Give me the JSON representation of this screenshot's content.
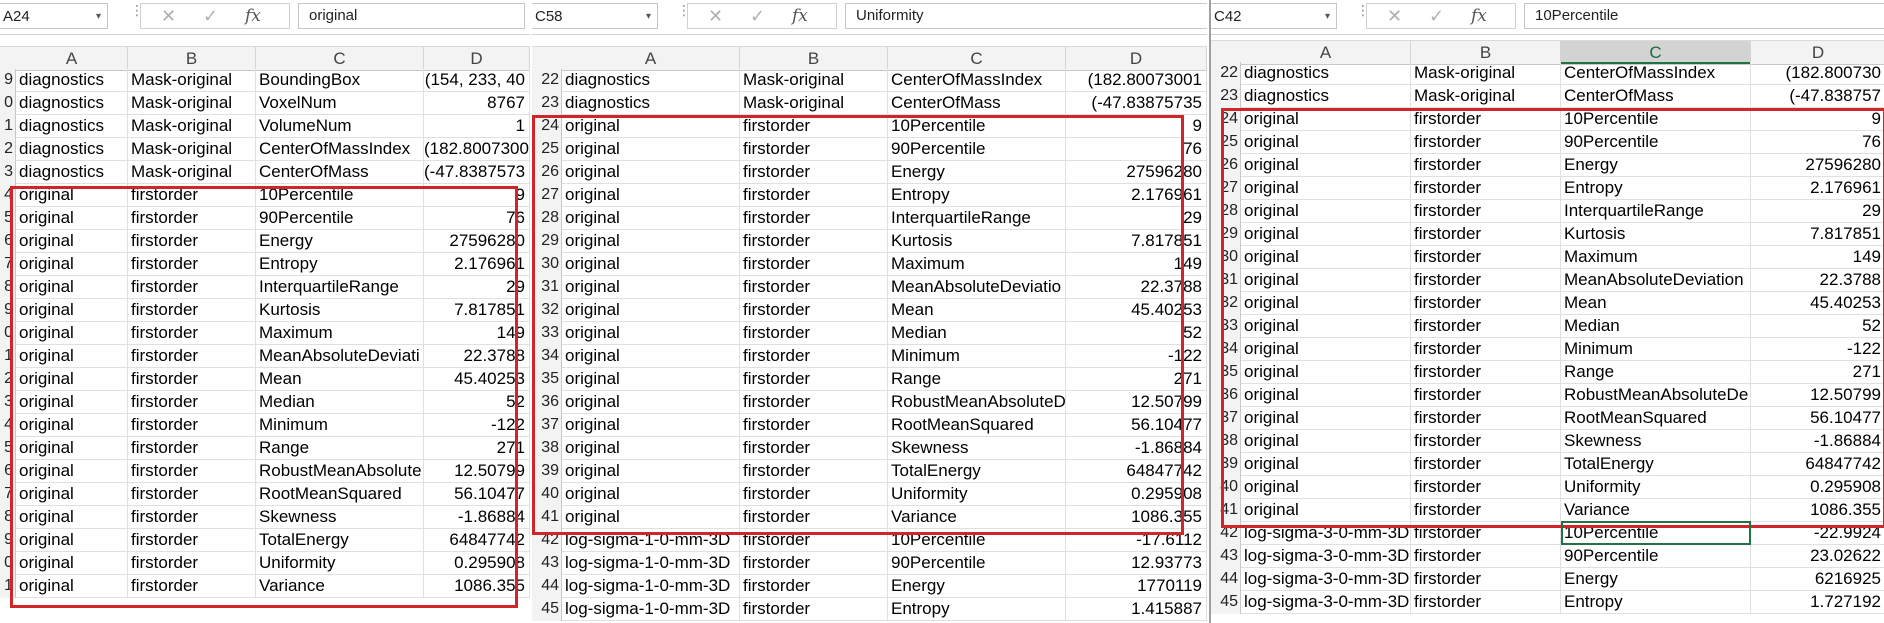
{
  "panels": [
    {
      "namebox": "A24",
      "formula": "original",
      "columns": [
        "A",
        "B",
        "C",
        "D"
      ],
      "rows": [
        {
          "n": "9",
          "a": "diagnostics",
          "b": "Mask-original",
          "c": "BoundingBox",
          "d": "(154, 233, 40"
        },
        {
          "n": "0",
          "a": "diagnostics",
          "b": "Mask-original",
          "c": "VoxelNum",
          "d": "8767"
        },
        {
          "n": "1",
          "a": "diagnostics",
          "b": "Mask-original",
          "c": "VolumeNum",
          "d": "1"
        },
        {
          "n": "2",
          "a": "diagnostics",
          "b": "Mask-original",
          "c": "CenterOfMassIndex",
          "d": "(182.8007300"
        },
        {
          "n": "3",
          "a": "diagnostics",
          "b": "Mask-original",
          "c": "CenterOfMass",
          "d": "(-47.8387573"
        },
        {
          "n": "4",
          "a": "original",
          "b": "firstorder",
          "c": "10Percentile",
          "d": "9"
        },
        {
          "n": "5",
          "a": "original",
          "b": "firstorder",
          "c": "90Percentile",
          "d": "76"
        },
        {
          "n": "6",
          "a": "original",
          "b": "firstorder",
          "c": "Energy",
          "d": "27596280"
        },
        {
          "n": "7",
          "a": "original",
          "b": "firstorder",
          "c": "Entropy",
          "d": "2.176961"
        },
        {
          "n": "8",
          "a": "original",
          "b": "firstorder",
          "c": "InterquartileRange",
          "d": "29"
        },
        {
          "n": "9",
          "a": "original",
          "b": "firstorder",
          "c": "Kurtosis",
          "d": "7.817851"
        },
        {
          "n": "0",
          "a": "original",
          "b": "firstorder",
          "c": "Maximum",
          "d": "149"
        },
        {
          "n": "1",
          "a": "original",
          "b": "firstorder",
          "c": "MeanAbsoluteDeviati",
          "d": "22.3788"
        },
        {
          "n": "2",
          "a": "original",
          "b": "firstorder",
          "c": "Mean",
          "d": "45.40253"
        },
        {
          "n": "3",
          "a": "original",
          "b": "firstorder",
          "c": "Median",
          "d": "52"
        },
        {
          "n": "4",
          "a": "original",
          "b": "firstorder",
          "c": "Minimum",
          "d": "-122"
        },
        {
          "n": "5",
          "a": "original",
          "b": "firstorder",
          "c": "Range",
          "d": "271"
        },
        {
          "n": "6",
          "a": "original",
          "b": "firstorder",
          "c": "RobustMeanAbsolute",
          "d": "12.50799"
        },
        {
          "n": "7",
          "a": "original",
          "b": "firstorder",
          "c": "RootMeanSquared",
          "d": "56.10477"
        },
        {
          "n": "8",
          "a": "original",
          "b": "firstorder",
          "c": "Skewness",
          "d": "-1.86884"
        },
        {
          "n": "9",
          "a": "original",
          "b": "firstorder",
          "c": "TotalEnergy",
          "d": "64847742"
        },
        {
          "n": "0",
          "a": "original",
          "b": "firstorder",
          "c": "Uniformity",
          "d": "0.295908"
        },
        {
          "n": "1",
          "a": "original",
          "b": "firstorder",
          "c": "Variance",
          "d": "1086.355"
        }
      ]
    },
    {
      "namebox": "C58",
      "formula": "Uniformity",
      "columns": [
        "A",
        "B",
        "C",
        "D"
      ],
      "rows": [
        {
          "n": "22",
          "a": "diagnostics",
          "b": "Mask-original",
          "c": "CenterOfMassIndex",
          "d": "(182.80073001"
        },
        {
          "n": "23",
          "a": "diagnostics",
          "b": "Mask-original",
          "c": "CenterOfMass",
          "d": "(-47.83875735"
        },
        {
          "n": "24",
          "a": "original",
          "b": "firstorder",
          "c": "10Percentile",
          "d": "9"
        },
        {
          "n": "25",
          "a": "original",
          "b": "firstorder",
          "c": "90Percentile",
          "d": "76"
        },
        {
          "n": "26",
          "a": "original",
          "b": "firstorder",
          "c": "Energy",
          "d": "27596280"
        },
        {
          "n": "27",
          "a": "original",
          "b": "firstorder",
          "c": "Entropy",
          "d": "2.176961"
        },
        {
          "n": "28",
          "a": "original",
          "b": "firstorder",
          "c": "InterquartileRange",
          "d": "29"
        },
        {
          "n": "29",
          "a": "original",
          "b": "firstorder",
          "c": "Kurtosis",
          "d": "7.817851"
        },
        {
          "n": "30",
          "a": "original",
          "b": "firstorder",
          "c": "Maximum",
          "d": "149"
        },
        {
          "n": "31",
          "a": "original",
          "b": "firstorder",
          "c": "MeanAbsoluteDeviatio",
          "d": "22.3788"
        },
        {
          "n": "32",
          "a": "original",
          "b": "firstorder",
          "c": "Mean",
          "d": "45.40253"
        },
        {
          "n": "33",
          "a": "original",
          "b": "firstorder",
          "c": "Median",
          "d": "52"
        },
        {
          "n": "34",
          "a": "original",
          "b": "firstorder",
          "c": "Minimum",
          "d": "-122"
        },
        {
          "n": "35",
          "a": "original",
          "b": "firstorder",
          "c": "Range",
          "d": "271"
        },
        {
          "n": "36",
          "a": "original",
          "b": "firstorder",
          "c": "RobustMeanAbsoluteD",
          "d": "12.50799"
        },
        {
          "n": "37",
          "a": "original",
          "b": "firstorder",
          "c": "RootMeanSquared",
          "d": "56.10477"
        },
        {
          "n": "38",
          "a": "original",
          "b": "firstorder",
          "c": "Skewness",
          "d": "-1.86884"
        },
        {
          "n": "39",
          "a": "original",
          "b": "firstorder",
          "c": "TotalEnergy",
          "d": "64847742"
        },
        {
          "n": "40",
          "a": "original",
          "b": "firstorder",
          "c": "Uniformity",
          "d": "0.295908"
        },
        {
          "n": "41",
          "a": "original",
          "b": "firstorder",
          "c": "Variance",
          "d": "1086.355"
        },
        {
          "n": "42",
          "a": "log-sigma-1-0-mm-3D",
          "b": "firstorder",
          "c": "10Percentile",
          "d": "-17.6112"
        },
        {
          "n": "43",
          "a": "log-sigma-1-0-mm-3D",
          "b": "firstorder",
          "c": "90Percentile",
          "d": "12.93773"
        },
        {
          "n": "44",
          "a": "log-sigma-1-0-mm-3D",
          "b": "firstorder",
          "c": "Energy",
          "d": "1770119"
        },
        {
          "n": "45",
          "a": "log-sigma-1-0-mm-3D",
          "b": "firstorder",
          "c": "Entropy",
          "d": "1.415887"
        }
      ]
    },
    {
      "namebox": "C42",
      "formula": "10Percentile",
      "columns": [
        "A",
        "B",
        "C",
        "D"
      ],
      "rows": [
        {
          "n": "22",
          "a": "diagnostics",
          "b": "Mask-original",
          "c": "CenterOfMassIndex",
          "d": "(182.800730"
        },
        {
          "n": "23",
          "a": "diagnostics",
          "b": "Mask-original",
          "c": "CenterOfMass",
          "d": "(-47.838757"
        },
        {
          "n": "24",
          "a": "original",
          "b": "firstorder",
          "c": "10Percentile",
          "d": "9"
        },
        {
          "n": "25",
          "a": "original",
          "b": "firstorder",
          "c": "90Percentile",
          "d": "76"
        },
        {
          "n": "26",
          "a": "original",
          "b": "firstorder",
          "c": "Energy",
          "d": "27596280"
        },
        {
          "n": "27",
          "a": "original",
          "b": "firstorder",
          "c": "Entropy",
          "d": "2.176961"
        },
        {
          "n": "28",
          "a": "original",
          "b": "firstorder",
          "c": "InterquartileRange",
          "d": "29"
        },
        {
          "n": "29",
          "a": "original",
          "b": "firstorder",
          "c": "Kurtosis",
          "d": "7.817851"
        },
        {
          "n": "30",
          "a": "original",
          "b": "firstorder",
          "c": "Maximum",
          "d": "149"
        },
        {
          "n": "31",
          "a": "original",
          "b": "firstorder",
          "c": "MeanAbsoluteDeviation",
          "d": "22.3788"
        },
        {
          "n": "32",
          "a": "original",
          "b": "firstorder",
          "c": "Mean",
          "d": "45.40253"
        },
        {
          "n": "33",
          "a": "original",
          "b": "firstorder",
          "c": "Median",
          "d": "52"
        },
        {
          "n": "34",
          "a": "original",
          "b": "firstorder",
          "c": "Minimum",
          "d": "-122"
        },
        {
          "n": "35",
          "a": "original",
          "b": "firstorder",
          "c": "Range",
          "d": "271"
        },
        {
          "n": "36",
          "a": "original",
          "b": "firstorder",
          "c": "RobustMeanAbsoluteDe",
          "d": "12.50799"
        },
        {
          "n": "37",
          "a": "original",
          "b": "firstorder",
          "c": "RootMeanSquared",
          "d": "56.10477"
        },
        {
          "n": "38",
          "a": "original",
          "b": "firstorder",
          "c": "Skewness",
          "d": "-1.86884"
        },
        {
          "n": "39",
          "a": "original",
          "b": "firstorder",
          "c": "TotalEnergy",
          "d": "64847742"
        },
        {
          "n": "40",
          "a": "original",
          "b": "firstorder",
          "c": "Uniformity",
          "d": "0.295908"
        },
        {
          "n": "41",
          "a": "original",
          "b": "firstorder",
          "c": "Variance",
          "d": "1086.355"
        },
        {
          "n": "42",
          "a": "log-sigma-3-0-mm-3D",
          "b": "firstorder",
          "c": "10Percentile",
          "d": "-22.9924"
        },
        {
          "n": "43",
          "a": "log-sigma-3-0-mm-3D",
          "b": "firstorder",
          "c": "90Percentile",
          "d": "23.02622"
        },
        {
          "n": "44",
          "a": "log-sigma-3-0-mm-3D",
          "b": "firstorder",
          "c": "Energy",
          "d": "6216925"
        },
        {
          "n": "45",
          "a": "log-sigma-3-0-mm-3D",
          "b": "firstorder",
          "c": "Entropy",
          "d": "1.727192"
        }
      ]
    }
  ],
  "icons": {
    "cancel": "✕",
    "enter": "✓",
    "function": "fx",
    "dropdown": "▾",
    "more": "⋮"
  },
  "colors": {
    "highlight_box": "#d0262a",
    "active_cell": "#217346"
  }
}
